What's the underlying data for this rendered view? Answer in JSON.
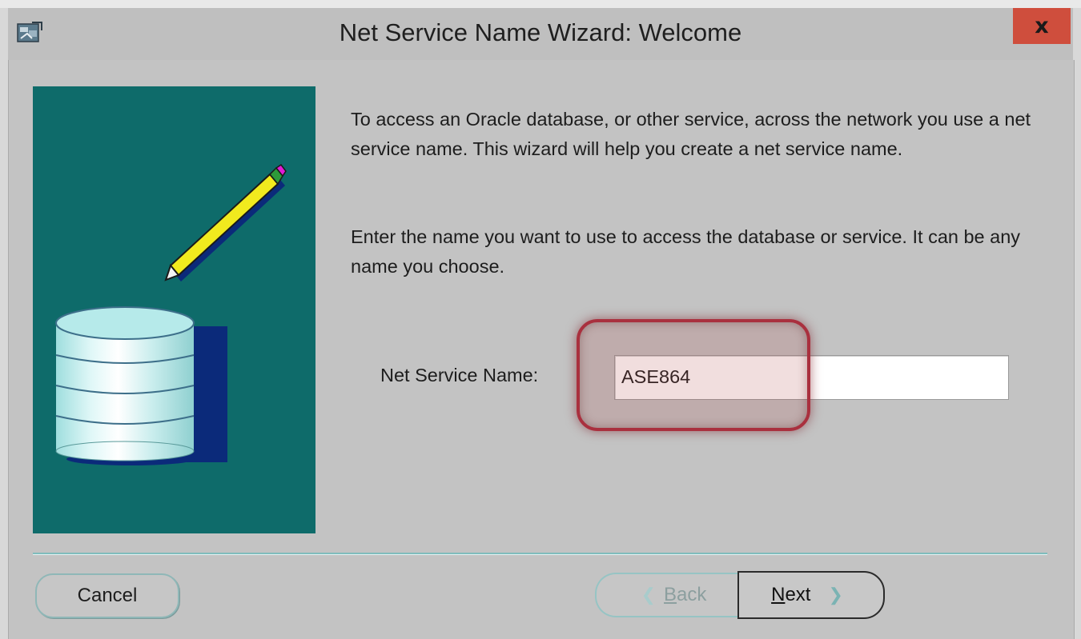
{
  "window": {
    "title": "Net Service Name Wizard: Welcome",
    "close_label": "x"
  },
  "main": {
    "description_1": "To access an Oracle database, or other service, across the network you use a net service name.  This wizard will help you create a net service name.",
    "description_2": "Enter the name you want to use to access the database or service. It can be any name you choose.",
    "field_label": "Net Service Name:",
    "field_value": "ASE864"
  },
  "buttons": {
    "cancel": "Cancel",
    "back_accel": "B",
    "back_rest": "ack",
    "next_accel": "N",
    "next_rest": "ext"
  },
  "icons": {
    "app": "wizard-app-icon",
    "database": "database-icon",
    "pencil": "pencil-icon",
    "back": "chevron-left-icon",
    "next": "chevron-right-icon"
  },
  "colors": {
    "image_panel": "#0e6b6a",
    "close_button": "#cf4e3d",
    "highlight": "#a9303e"
  }
}
